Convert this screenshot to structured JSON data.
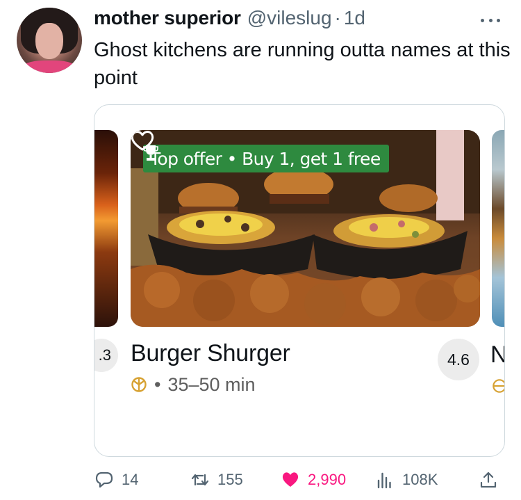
{
  "tweet": {
    "author": {
      "display_name": "mother superior",
      "handle": "@vileslug",
      "separator": "·",
      "time": "1d"
    },
    "text": "Ghost kitchens are running outta names at this point",
    "card": {
      "offer_badge": "Top offer • Buy 1, get 1 free",
      "prev_rating": ".3",
      "restaurant_name": "Burger Shurger",
      "meta_separator": "•",
      "delivery_time": "35–50 min",
      "rating": "4.6",
      "next_name_partial": "N"
    },
    "actions": {
      "replies": "14",
      "reposts": "155",
      "likes": "2,990",
      "views": "108K"
    }
  },
  "colors": {
    "like_pink": "#f91880",
    "secondary_text": "#536471",
    "offer_green": "#2e8a3f",
    "rating_bg": "#ececec"
  },
  "icons": [
    "more-icon",
    "trophy-icon",
    "heart-outline-icon",
    "delivery-icon",
    "reply-icon",
    "repost-icon",
    "like-icon",
    "views-icon",
    "share-icon"
  ]
}
